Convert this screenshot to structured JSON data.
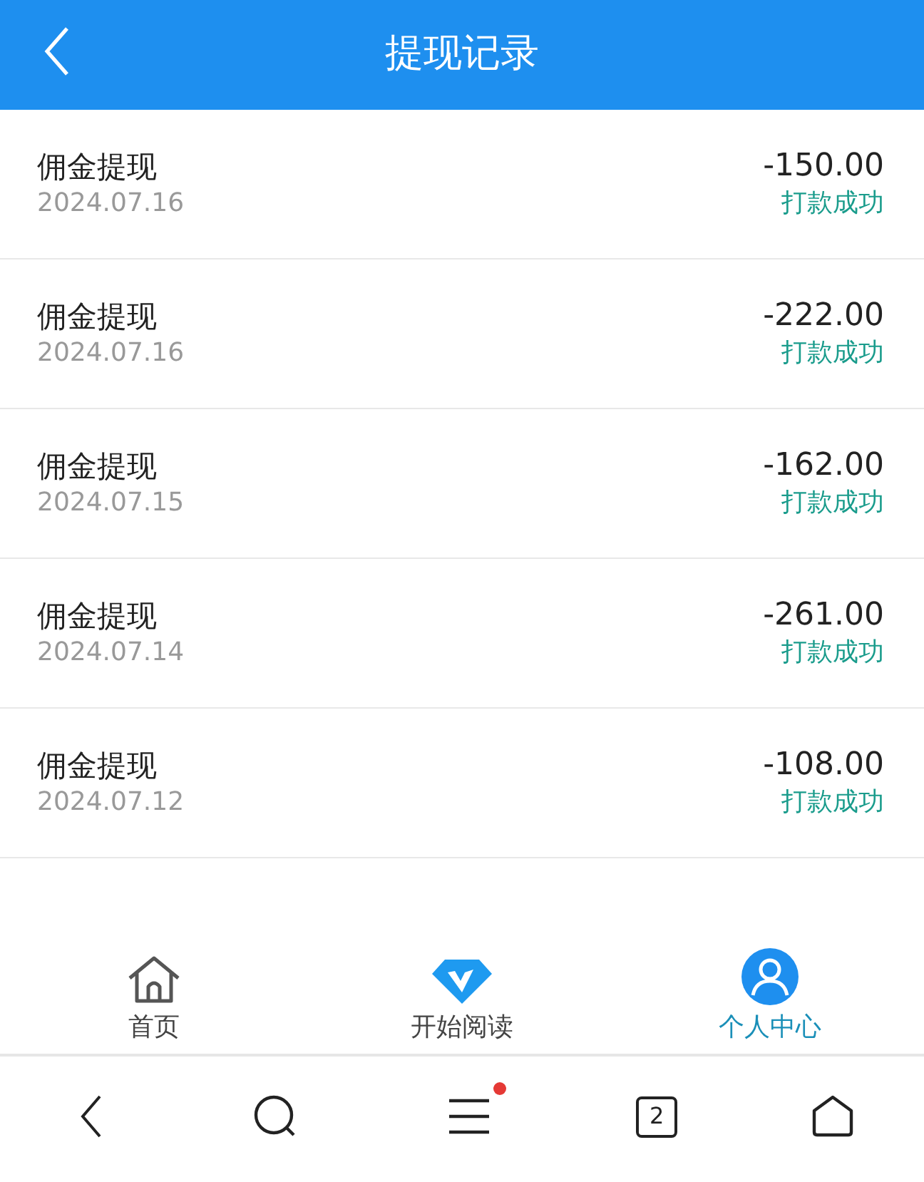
{
  "header": {
    "title": "提现记录"
  },
  "records": [
    {
      "title": "佣金提现",
      "date": "2024.07.16",
      "amount": "-150.00",
      "status": "打款成功"
    },
    {
      "title": "佣金提现",
      "date": "2024.07.16",
      "amount": "-222.00",
      "status": "打款成功"
    },
    {
      "title": "佣金提现",
      "date": "2024.07.15",
      "amount": "-162.00",
      "status": "打款成功"
    },
    {
      "title": "佣金提现",
      "date": "2024.07.14",
      "amount": "-261.00",
      "status": "打款成功"
    },
    {
      "title": "佣金提现",
      "date": "2024.07.12",
      "amount": "-108.00",
      "status": "打款成功"
    }
  ],
  "tab_bar": [
    {
      "kind": "home",
      "label": "首页",
      "selected": false
    },
    {
      "kind": "diamond",
      "label": "开始阅读",
      "selected": false
    },
    {
      "kind": "profile",
      "label": "个人中心",
      "selected": true
    }
  ],
  "browser_bar": {
    "tab_count": "2",
    "menu_notification": true
  }
}
